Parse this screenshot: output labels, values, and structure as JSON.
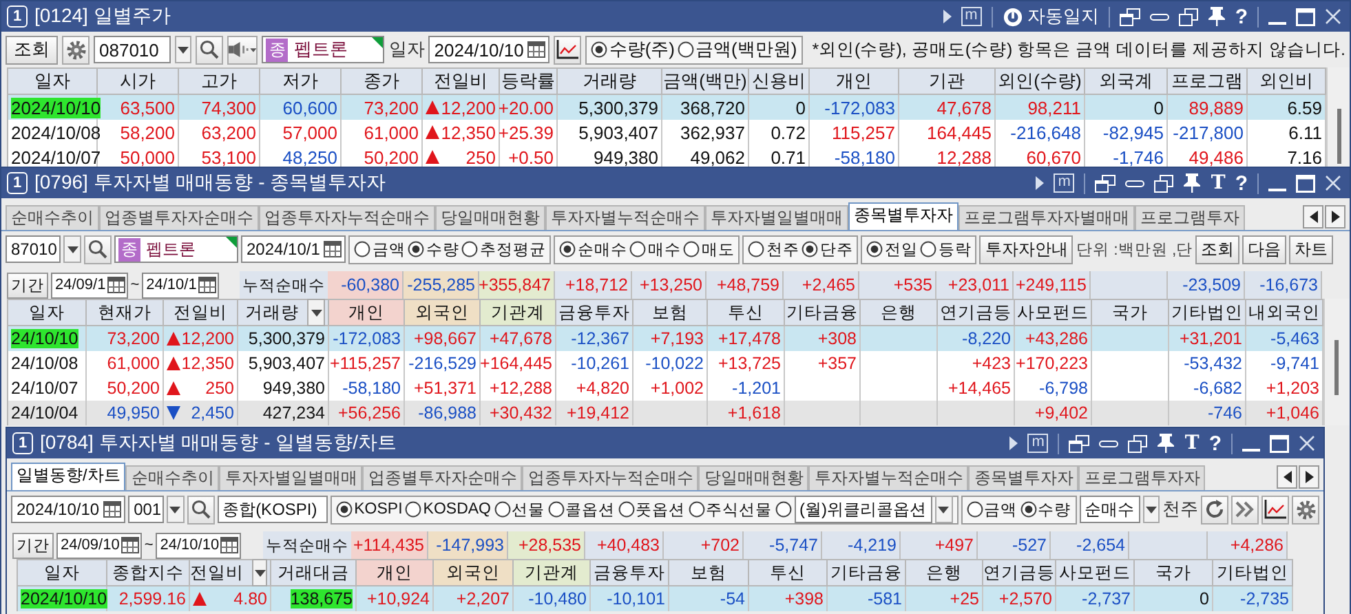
{
  "daily_price_window": {
    "badge": "1",
    "title": "[0124] 일별주가",
    "memo_glyph": "m",
    "auto_log_label": "자동일지",
    "help_glyph": "?",
    "query_button": "조회",
    "code": "087010",
    "stock_tag": "종",
    "stock_name": "펩트론",
    "date_label": "일자",
    "date": "2024/10/10",
    "radios": [
      {
        "label": "수량(주)",
        "selected": true
      },
      {
        "label": "금액(백만원)",
        "selected": false
      }
    ],
    "notice": "*외인(수량), 공매도(수량) 항목은 금액 데이터를 제공하지 않습니다.",
    "columns": [
      {
        "label": "일자",
        "kind": "date"
      },
      {
        "label": "시가",
        "kind": "number"
      },
      {
        "label": "고가",
        "kind": "number"
      },
      {
        "label": "저가",
        "kind": "number"
      },
      {
        "label": "종가",
        "kind": "number"
      },
      {
        "label": "전일비",
        "kind": "change"
      },
      {
        "label": "등락률",
        "kind": "number"
      },
      {
        "label": "거래량",
        "kind": "number"
      },
      {
        "label": "금액(백만)",
        "kind": "number"
      },
      {
        "label": "신용비",
        "kind": "number"
      },
      {
        "label": "개인",
        "kind": "number"
      },
      {
        "label": "기관",
        "kind": "number"
      },
      {
        "label": "외인(수량)",
        "kind": "number"
      },
      {
        "label": "외국계",
        "kind": "number"
      },
      {
        "label": "프로그램",
        "kind": "number"
      },
      {
        "label": "외인비",
        "kind": "number"
      }
    ],
    "rows": [
      {
        "selected": true,
        "cells": [
          {
            "text": "2024/10/10",
            "highlight": true
          },
          {
            "text": "63,500",
            "color": "#e0161c"
          },
          {
            "text": "74,300",
            "color": "#e0161c"
          },
          {
            "text": "60,600",
            "color": "#1a4fc4"
          },
          {
            "text": "73,200",
            "color": "#e0161c"
          },
          {
            "text": "12,200",
            "color": "#e0161c",
            "kind": "rise"
          },
          {
            "text": "+20.00",
            "color": "#e0161c"
          },
          {
            "text": "5,300,379",
            "color": "#111111"
          },
          {
            "text": "368,720",
            "color": "#111111"
          },
          {
            "text": "0",
            "color": "#111111"
          },
          {
            "text": "-172,083",
            "color": "#1a4fc4"
          },
          {
            "text": "47,678",
            "color": "#e0161c"
          },
          {
            "text": "98,211",
            "color": "#e0161c"
          },
          {
            "text": "0",
            "color": "#111111"
          },
          {
            "text": "89,889",
            "color": "#e0161c"
          },
          {
            "text": "6.59",
            "color": "#111111"
          }
        ]
      },
      {
        "selected": false,
        "cells": [
          {
            "text": "2024/10/08",
            "color": "#111111"
          },
          {
            "text": "58,200",
            "color": "#e0161c"
          },
          {
            "text": "63,200",
            "color": "#e0161c"
          },
          {
            "text": "57,000",
            "color": "#e0161c"
          },
          {
            "text": "61,000",
            "color": "#e0161c"
          },
          {
            "text": "12,350",
            "color": "#e0161c",
            "kind": "rise"
          },
          {
            "text": "+25.39",
            "color": "#e0161c"
          },
          {
            "text": "5,903,407",
            "color": "#111111"
          },
          {
            "text": "362,937",
            "color": "#111111"
          },
          {
            "text": "0.72",
            "color": "#111111"
          },
          {
            "text": "115,257",
            "color": "#e0161c"
          },
          {
            "text": "164,445",
            "color": "#e0161c"
          },
          {
            "text": "-216,648",
            "color": "#1a4fc4"
          },
          {
            "text": "-82,945",
            "color": "#1a4fc4"
          },
          {
            "text": "-217,800",
            "color": "#1a4fc4"
          },
          {
            "text": "6.11",
            "color": "#111111"
          }
        ]
      },
      {
        "selected": false,
        "cells": [
          {
            "text": "2024/10/07",
            "color": "#111111"
          },
          {
            "text": "50,000",
            "color": "#e0161c"
          },
          {
            "text": "53,100",
            "color": "#e0161c"
          },
          {
            "text": "48,250",
            "color": "#1a4fc4"
          },
          {
            "text": "50,200",
            "color": "#e0161c"
          },
          {
            "text": "250",
            "color": "#e0161c",
            "kind": "rise"
          },
          {
            "text": "+0.50",
            "color": "#e0161c"
          },
          {
            "text": "949,380",
            "color": "#111111"
          },
          {
            "text": "49,062",
            "color": "#111111"
          },
          {
            "text": "0.71",
            "color": "#111111"
          },
          {
            "text": "-58,180",
            "color": "#1a4fc4"
          },
          {
            "text": "12,288",
            "color": "#e0161c"
          },
          {
            "text": "60,670",
            "color": "#e0161c"
          },
          {
            "text": "-1,746",
            "color": "#1a4fc4"
          },
          {
            "text": "49,486",
            "color": "#e0161c"
          },
          {
            "text": "7.16",
            "color": "#111111"
          }
        ]
      }
    ]
  },
  "investor_by_stock_window": {
    "badge": "1",
    "title": "[0796] 투자자별 매매동향 - 종목별투자자",
    "memo_glyph": "m",
    "font_glyph": "T",
    "help_glyph": "?",
    "tabs": [
      {
        "label": "순매수추이",
        "selected": false
      },
      {
        "label": "업종별투자자순매수",
        "selected": false
      },
      {
        "label": "업종투자자누적순매수",
        "selected": false
      },
      {
        "label": "당일매매현황",
        "selected": false
      },
      {
        "label": "투자자별누적순매수",
        "selected": false
      },
      {
        "label": "투자자별일별매매",
        "selected": false
      },
      {
        "label": "종목별투자자",
        "selected": true
      },
      {
        "label": "프로그램투자자별매매",
        "selected": false
      },
      {
        "label": "프로그램투자",
        "selected": false
      }
    ],
    "code": "87010",
    "stock_tag": "종",
    "stock_name": "펩트론",
    "date": "2024/10/1",
    "radio_groups": [
      [
        {
          "label": "금액",
          "selected": false
        },
        {
          "label": "수량",
          "selected": true
        },
        {
          "label": "추정평균",
          "selected": false
        }
      ],
      [
        {
          "label": "순매수",
          "selected": true
        },
        {
          "label": "매수",
          "selected": false
        },
        {
          "label": "매도",
          "selected": false
        }
      ],
      [
        {
          "label": "천주",
          "selected": false
        },
        {
          "label": "단주",
          "selected": true
        }
      ],
      [
        {
          "label": "전일",
          "selected": true
        },
        {
          "label": "등락",
          "selected": false
        }
      ]
    ],
    "guide_button": "투자자안내",
    "unit_text": "단위 :백만원 ,단",
    "buttons": [
      "조회",
      "다음",
      "차트"
    ],
    "period_button": "기간",
    "period_from": "24/09/1",
    "tilde": "~",
    "period_to": "24/10/1",
    "cumulative_label": "누적순매수",
    "summary": [
      {
        "kind": "value",
        "text": "-60,380",
        "color": "#1a4fc4"
      },
      {
        "kind": "value",
        "text": "-255,285",
        "color": "#1a4fc4"
      },
      {
        "kind": "value",
        "text": "+355,847",
        "color": "#e0161c"
      },
      {
        "kind": "value",
        "text": "+18,712",
        "color": "#e0161c"
      },
      {
        "kind": "value",
        "text": "+13,250",
        "color": "#e0161c"
      },
      {
        "kind": "value",
        "text": "+48,759",
        "color": "#e0161c"
      },
      {
        "kind": "value",
        "text": "+2,465",
        "color": "#e0161c"
      },
      {
        "kind": "value",
        "text": "+535",
        "color": "#e0161c"
      },
      {
        "kind": "value",
        "text": "+23,011",
        "color": "#e0161c"
      },
      {
        "kind": "value",
        "text": "+249,115",
        "color": "#e0161c"
      },
      {
        "kind": "blank"
      },
      {
        "kind": "value",
        "text": "-23,509",
        "color": "#1a4fc4"
      },
      {
        "kind": "value",
        "text": "-16,673",
        "color": "#1a4fc4"
      }
    ],
    "columns": [
      {
        "label": "일자",
        "kind": "date"
      },
      {
        "label": "현재가",
        "kind": "number"
      },
      {
        "label": "전일비",
        "kind": "change"
      },
      {
        "label": "거래량",
        "kind": "number",
        "header_menu": true
      },
      {
        "label": "개인",
        "kind": "number",
        "color": "#f3d3ce"
      },
      {
        "label": "외국인",
        "kind": "number",
        "color": "#efdfc5"
      },
      {
        "label": "기관계",
        "kind": "number",
        "color": "#e3ebcf"
      },
      {
        "label": "금융투자",
        "kind": "number"
      },
      {
        "label": "보험",
        "kind": "number"
      },
      {
        "label": "투신",
        "kind": "number"
      },
      {
        "label": "기타금융",
        "kind": "number"
      },
      {
        "label": "은행",
        "kind": "number"
      },
      {
        "label": "연기금등",
        "kind": "number"
      },
      {
        "label": "사모펀드",
        "kind": "number"
      },
      {
        "label": "국가",
        "kind": "number"
      },
      {
        "label": "기타법인",
        "kind": "number"
      },
      {
        "label": "내외국인",
        "kind": "number"
      }
    ],
    "rows": [
      {
        "selected": true,
        "shaded": false,
        "cells": [
          {
            "text": "24/10/10",
            "highlight": true
          },
          {
            "text": "73,200",
            "color": "#e0161c"
          },
          {
            "text": "12,200",
            "color": "#e0161c",
            "kind": "rise"
          },
          {
            "text": "5,300,379",
            "color": "#111111"
          },
          {
            "text": "-172,083",
            "color": "#1a4fc4"
          },
          {
            "text": "+98,667",
            "color": "#e0161c"
          },
          {
            "text": "+47,678",
            "color": "#e0161c"
          },
          {
            "text": "-12,367",
            "color": "#1a4fc4"
          },
          {
            "text": "+7,193",
            "color": "#e0161c"
          },
          {
            "text": "+17,478",
            "color": "#e0161c"
          },
          {
            "text": "+308",
            "color": "#e0161c"
          },
          {
            "kind": "blank"
          },
          {
            "text": "-8,220",
            "color": "#1a4fc4"
          },
          {
            "text": "+43,286",
            "color": "#e0161c"
          },
          {
            "kind": "blank"
          },
          {
            "text": "+31,201",
            "color": "#e0161c"
          },
          {
            "text": "-5,463",
            "color": "#1a4fc4"
          }
        ]
      },
      {
        "selected": false,
        "shaded": false,
        "cells": [
          {
            "text": "24/10/08",
            "color": "#111111"
          },
          {
            "text": "61,000",
            "color": "#e0161c"
          },
          {
            "text": "12,350",
            "color": "#e0161c",
            "kind": "rise"
          },
          {
            "text": "5,903,407",
            "color": "#111111"
          },
          {
            "text": "+115,257",
            "color": "#e0161c"
          },
          {
            "text": "-216,529",
            "color": "#1a4fc4"
          },
          {
            "text": "+164,445",
            "color": "#e0161c"
          },
          {
            "text": "-10,261",
            "color": "#1a4fc4"
          },
          {
            "text": "-10,022",
            "color": "#1a4fc4"
          },
          {
            "text": "+13,725",
            "color": "#e0161c"
          },
          {
            "text": "+357",
            "color": "#e0161c"
          },
          {
            "kind": "blank"
          },
          {
            "text": "+423",
            "color": "#e0161c"
          },
          {
            "text": "+170,223",
            "color": "#e0161c"
          },
          {
            "kind": "blank"
          },
          {
            "text": "-53,432",
            "color": "#1a4fc4"
          },
          {
            "text": "-9,741",
            "color": "#1a4fc4"
          }
        ]
      },
      {
        "selected": false,
        "shaded": false,
        "cells": [
          {
            "text": "24/10/07",
            "color": "#111111"
          },
          {
            "text": "50,200",
            "color": "#e0161c"
          },
          {
            "text": "250",
            "color": "#e0161c",
            "kind": "rise"
          },
          {
            "text": "949,380",
            "color": "#111111"
          },
          {
            "text": "-58,180",
            "color": "#1a4fc4"
          },
          {
            "text": "+51,371",
            "color": "#e0161c"
          },
          {
            "text": "+12,288",
            "color": "#e0161c"
          },
          {
            "text": "+4,820",
            "color": "#e0161c"
          },
          {
            "text": "+1,002",
            "color": "#e0161c"
          },
          {
            "text": "-1,201",
            "color": "#1a4fc4"
          },
          {
            "kind": "blank"
          },
          {
            "kind": "blank"
          },
          {
            "text": "+14,465",
            "color": "#e0161c"
          },
          {
            "text": "-6,798",
            "color": "#1a4fc4"
          },
          {
            "kind": "blank"
          },
          {
            "text": "-6,682",
            "color": "#1a4fc4"
          },
          {
            "text": "+1,203",
            "color": "#e0161c"
          }
        ]
      },
      {
        "selected": false,
        "shaded": true,
        "cells": [
          {
            "text": "24/10/04",
            "color": "#111111"
          },
          {
            "text": "49,950",
            "color": "#1a4fc4"
          },
          {
            "text": "2,450",
            "color": "#1a4fc4",
            "kind": "fall"
          },
          {
            "text": "427,234",
            "color": "#111111"
          },
          {
            "text": "+56,256",
            "color": "#e0161c"
          },
          {
            "text": "-86,988",
            "color": "#1a4fc4"
          },
          {
            "text": "+30,432",
            "color": "#e0161c"
          },
          {
            "text": "+19,412",
            "color": "#e0161c"
          },
          {
            "kind": "blank"
          },
          {
            "text": "+1,618",
            "color": "#e0161c"
          },
          {
            "kind": "blank"
          },
          {
            "kind": "blank"
          },
          {
            "kind": "blank"
          },
          {
            "text": "+9,402",
            "color": "#e0161c"
          },
          {
            "kind": "blank"
          },
          {
            "text": "-746",
            "color": "#1a4fc4"
          },
          {
            "text": "+1,046",
            "color": "#e0161c"
          }
        ]
      }
    ]
  },
  "daily_trend_window": {
    "badge": "1",
    "title": "[0784] 투자자별 매매동향 - 일별동향/차트",
    "memo_glyph": "m",
    "font_glyph": "T",
    "help_glyph": "?",
    "tabs": [
      {
        "label": "일별동향/차트",
        "selected": true
      },
      {
        "label": "순매수추이",
        "selected": false
      },
      {
        "label": "투자자별일별매매",
        "selected": false
      },
      {
        "label": "업종별투자자순매수",
        "selected": false
      },
      {
        "label": "업종투자자누적순매수",
        "selected": false
      },
      {
        "label": "당일매매현황",
        "selected": false
      },
      {
        "label": "투자자별누적순매수",
        "selected": false
      },
      {
        "label": "종목별투자자",
        "selected": false
      },
      {
        "label": "프로그램투자자",
        "selected": false
      }
    ],
    "date": "2024/10/10",
    "market_code": "001",
    "market_name": "종합(KOSPI)",
    "market_radios": [
      {
        "label": "KOSPI",
        "selected": true
      },
      {
        "label": "KOSDAQ",
        "selected": false
      },
      {
        "label": "선물",
        "selected": false
      },
      {
        "label": "콜옵션",
        "selected": false
      },
      {
        "label": "풋옵션",
        "selected": false
      },
      {
        "label": "주식선물",
        "selected": false
      }
    ],
    "weekly_option": {
      "selected": false,
      "value": "(월)위클리콜옵션"
    },
    "unit_radios": [
      {
        "label": "금액",
        "selected": false
      },
      {
        "label": "수량",
        "selected": true
      }
    ],
    "mode_select": "순매수",
    "unit_label": "천주",
    "period_button": "기간",
    "period_from": "24/09/10",
    "tilde": "~",
    "period_to": "24/10/10",
    "cumulative_label": "누적순매수",
    "summary": [
      {
        "kind": "value",
        "text": "+114,435",
        "color": "#e0161c"
      },
      {
        "kind": "value",
        "text": "-147,993",
        "color": "#1a4fc4"
      },
      {
        "kind": "value",
        "text": "+28,535",
        "color": "#e0161c"
      },
      {
        "kind": "value",
        "text": "+40,483",
        "color": "#e0161c"
      },
      {
        "kind": "value",
        "text": "+702",
        "color": "#e0161c"
      },
      {
        "kind": "value",
        "text": "-5,747",
        "color": "#1a4fc4"
      },
      {
        "kind": "value",
        "text": "-4,219",
        "color": "#1a4fc4"
      },
      {
        "kind": "value",
        "text": "+497",
        "color": "#e0161c"
      },
      {
        "kind": "value",
        "text": "-527",
        "color": "#1a4fc4"
      },
      {
        "kind": "value",
        "text": "-2,654",
        "color": "#1a4fc4"
      },
      {
        "kind": "blank"
      },
      {
        "kind": "value",
        "text": "+4,286",
        "color": "#e0161c"
      }
    ],
    "columns": [
      {
        "label": "일자",
        "kind": "date"
      },
      {
        "label": "종합지수",
        "kind": "number"
      },
      {
        "label": "전일비",
        "kind": "change",
        "header_menu": true
      },
      {
        "label": "거래대금",
        "kind": "number"
      },
      {
        "label": "개인",
        "kind": "number",
        "color": "#f3d3ce"
      },
      {
        "label": "외국인",
        "kind": "number",
        "color": "#efdfc5"
      },
      {
        "label": "기관계",
        "kind": "number",
        "color": "#e3ebcf"
      },
      {
        "label": "금융투자",
        "kind": "number"
      },
      {
        "label": "보험",
        "kind": "number"
      },
      {
        "label": "투신",
        "kind": "number"
      },
      {
        "label": "기타금융",
        "kind": "number"
      },
      {
        "label": "은행",
        "kind": "number"
      },
      {
        "label": "연기금등",
        "kind": "number"
      },
      {
        "label": "사모펀드",
        "kind": "number"
      },
      {
        "label": "국가",
        "kind": "number"
      },
      {
        "label": "기타법인",
        "kind": "number"
      }
    ],
    "rows": [
      {
        "selected": true,
        "cells": [
          {
            "text": "2024/10/10",
            "highlight": true
          },
          {
            "text": "2,599.16",
            "color": "#e0161c"
          },
          {
            "text": "4.80",
            "color": "#e0161c",
            "kind": "rise"
          },
          {
            "text": "138,675",
            "highlight": true
          },
          {
            "text": "+10,924",
            "color": "#e0161c"
          },
          {
            "text": "+2,207",
            "color": "#e0161c"
          },
          {
            "text": "-10,480",
            "color": "#1a4fc4"
          },
          {
            "text": "-10,101",
            "color": "#1a4fc4"
          },
          {
            "text": "-54",
            "color": "#1a4fc4"
          },
          {
            "text": "+398",
            "color": "#e0161c"
          },
          {
            "text": "-581",
            "color": "#1a4fc4"
          },
          {
            "text": "+25",
            "color": "#e0161c"
          },
          {
            "text": "+2,570",
            "color": "#e0161c"
          },
          {
            "text": "-2,737",
            "color": "#1a4fc4"
          },
          {
            "text": "0",
            "color": "#111111"
          },
          {
            "text": "-2,735",
            "color": "#1a4fc4"
          }
        ]
      }
    ]
  }
}
